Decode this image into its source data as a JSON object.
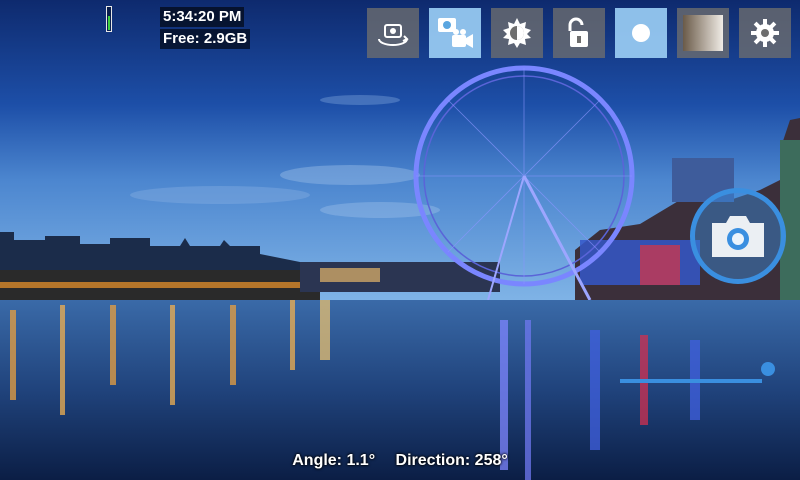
{
  "status": {
    "time": "5:34:20 PM",
    "free_space": "Free: 2.9GB",
    "battery_level": 0.65,
    "battery_color": "#3fd13f"
  },
  "toolbar": [
    {
      "name": "switch-camera-button",
      "icon": "camera-rotate-icon",
      "active": false
    },
    {
      "name": "photo-video-mode-button",
      "icon": "camera-video-icon",
      "active": true
    },
    {
      "name": "exposure-button",
      "icon": "exposure-icon",
      "active": false
    },
    {
      "name": "exposure-lock-button",
      "icon": "unlock-icon",
      "active": false
    },
    {
      "name": "focus-button",
      "icon": "focus-dot-icon",
      "active": true
    },
    {
      "name": "color-effect-button",
      "icon": "gradient-icon",
      "active": false
    },
    {
      "name": "settings-button",
      "icon": "gear-icon",
      "active": false
    }
  ],
  "shutter": {
    "icon": "camera-icon",
    "color": "#3a8fe0"
  },
  "zoom": {
    "level": 1.0
  },
  "readout": {
    "angle": "Angle: 1.1°",
    "direction": "Direction: 258°"
  },
  "colors": {
    "accent": "#3a8fe0",
    "toolbar_active": "#96c8f0"
  }
}
